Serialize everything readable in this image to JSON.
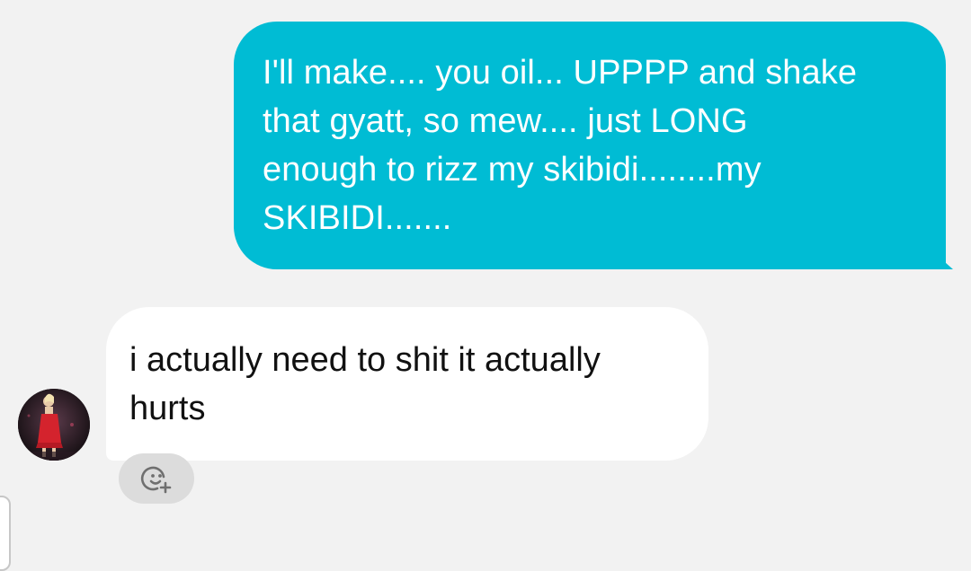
{
  "conversation": {
    "sent_message": {
      "text": "I'll make.... you oil... UPPPP and shake\nthat gyatt, so mew.... just LONG\nenough to rizz my skibidi........my\nSKIBIDI.......",
      "bubble_color": "#00bcd4",
      "text_color": "#ffffff"
    },
    "received_message": {
      "text": "i actually need to shit it actually\nhurts",
      "bubble_color": "#ffffff",
      "text_color": "#111111"
    },
    "avatar": {
      "icon": "profile-avatar"
    },
    "reaction_button": {
      "icon": "add-reaction-icon"
    }
  },
  "colors": {
    "background": "#f2f2f2",
    "accent": "#00bcd4"
  }
}
